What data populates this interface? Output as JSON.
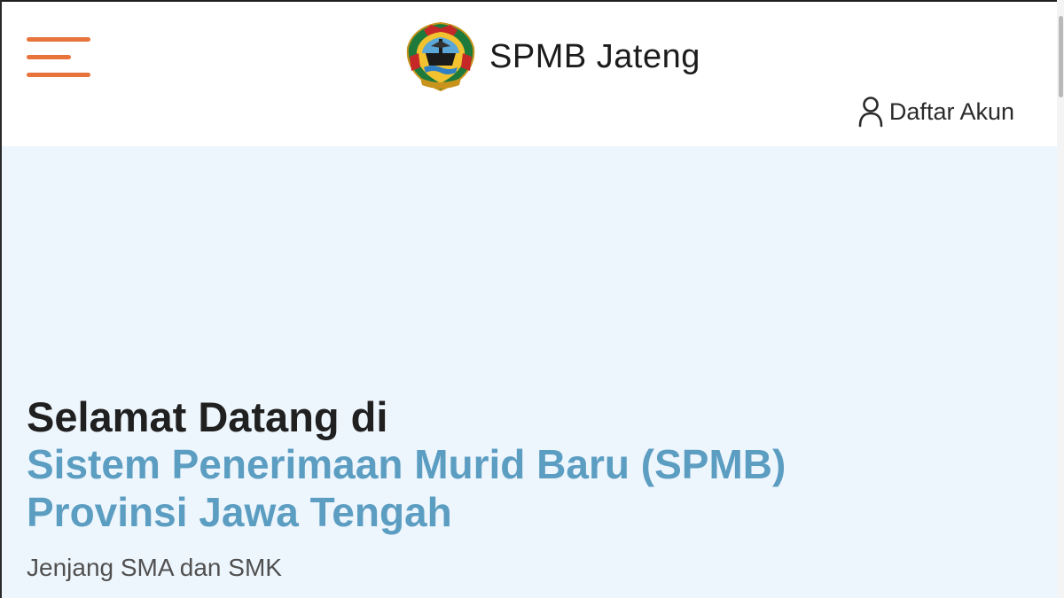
{
  "header": {
    "brand_title": "SPMB Jateng",
    "register_label": "Daftar Akun"
  },
  "hero": {
    "greeting": "Selamat Datang di",
    "title_line1": "Sistem Penerimaan Murid Baru (SPMB)",
    "title_line2": "Provinsi Jawa Tengah",
    "subtitle": "Jenjang SMA dan SMK"
  },
  "icons": {
    "menu": "hamburger-menu-icon",
    "logo": "central-java-crest-icon",
    "user": "user-icon"
  },
  "colors": {
    "accent_orange": "#e8743c",
    "title_blue": "#5c9dc2",
    "hero_background": "#eef6fd",
    "text_dark": "#202020"
  }
}
